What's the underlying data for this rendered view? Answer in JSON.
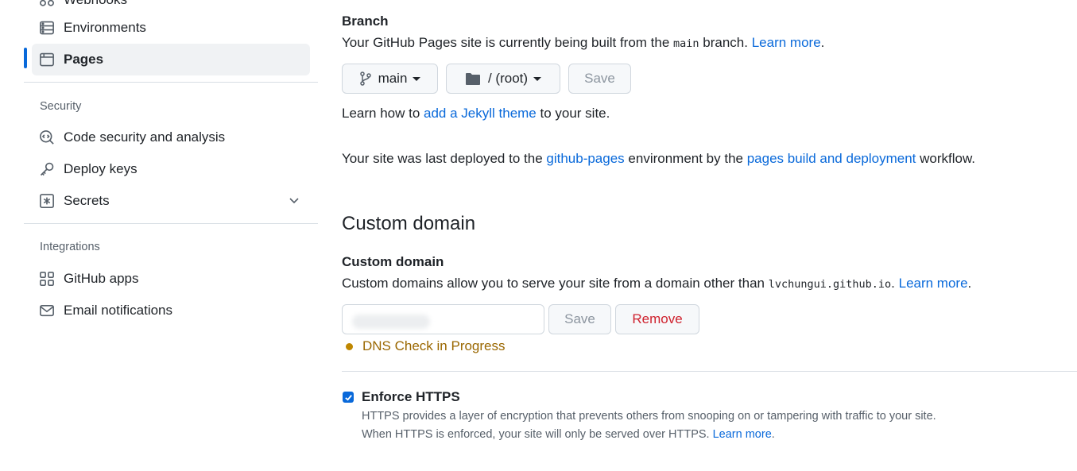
{
  "sidebar": {
    "top_partial": "Webhooks",
    "items_top": [
      {
        "label": "Environments",
        "icon": "server-icon"
      },
      {
        "label": "Pages",
        "icon": "browser-icon",
        "active": true
      }
    ],
    "security_heading": "Security",
    "security_items": [
      {
        "label": "Code security and analysis",
        "icon": "codescan-icon"
      },
      {
        "label": "Deploy keys",
        "icon": "key-icon"
      },
      {
        "label": "Secrets",
        "icon": "asterisk-icon",
        "expandable": true
      }
    ],
    "integrations_heading": "Integrations",
    "integration_items": [
      {
        "label": "GitHub apps",
        "icon": "apps-icon"
      },
      {
        "label": "Email notifications",
        "icon": "mail-icon"
      }
    ]
  },
  "branch": {
    "heading": "Branch",
    "desc_prefix": "Your GitHub Pages site is currently being built from the ",
    "branch_code": "main",
    "desc_suffix": " branch.",
    "learn_more": "Learn more",
    "branch_button": "main",
    "folder_button": "/ (root)",
    "save_button": "Save",
    "jekyll_prefix": "Learn how to ",
    "jekyll_link": "add a Jekyll theme",
    "jekyll_suffix": " to your site.",
    "deploy_prefix": "Your site was last deployed to the ",
    "deploy_env_link": "github-pages",
    "deploy_mid": " environment by the ",
    "deploy_workflow_link": "pages build and deployment",
    "deploy_suffix": " workflow."
  },
  "custom_domain": {
    "section_title": "Custom domain",
    "heading": "Custom domain",
    "desc_prefix": "Custom domains allow you to serve your site from a domain other than ",
    "domain_code": "lvchungui.github.io",
    "desc_suffix": ".",
    "learn_more": "Learn more",
    "input_value": "",
    "save_button": "Save",
    "remove_button": "Remove",
    "status_text": "DNS Check in Progress",
    "status_color": "#bf8700"
  },
  "https": {
    "label": "Enforce HTTPS",
    "checked": true,
    "note_line1": "HTTPS provides a layer of encryption that prevents others from snooping on or tampering with traffic to your site.",
    "note_line2_prefix": "When HTTPS is enforced, your site will only be served over HTTPS.",
    "learn_more": "Learn more"
  },
  "colors": {
    "accent": "#0969da",
    "danger": "#cf222e",
    "attention": "#9a6700"
  }
}
